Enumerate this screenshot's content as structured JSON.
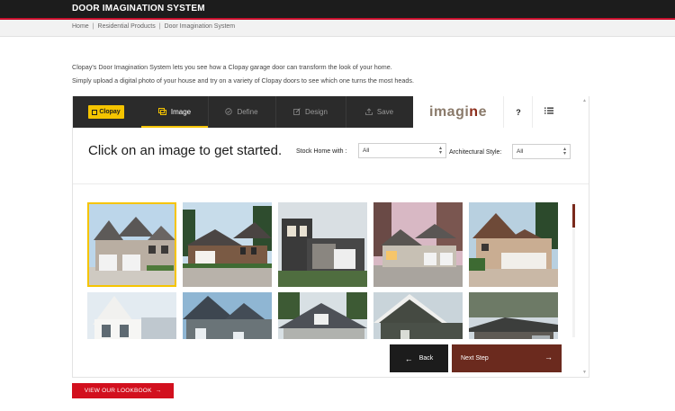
{
  "header": {
    "title": "DOOR IMAGINATION SYSTEM"
  },
  "breadcrumbs": [
    "Home",
    "Residential Products",
    "Door Imagination System"
  ],
  "intro": {
    "line1": "Clopay's Door Imagination System lets you see how a Clopay garage door can transform the look of your home.",
    "line2": "Simply upload a digital photo of your house and try on a variety of Clopay doors to see which one turns the most heads."
  },
  "nav": {
    "logo": "Clopay",
    "tabs": [
      {
        "label": "Image",
        "icon": "image-icon"
      },
      {
        "label": "Define",
        "icon": "check-icon"
      },
      {
        "label": "Design",
        "icon": "edit-icon"
      },
      {
        "label": "Save",
        "icon": "upload-icon"
      }
    ],
    "brand_main": "imagi",
    "brand_accent": "n",
    "brand_tail": "e",
    "help": "?",
    "menu_icon": "list-icon"
  },
  "filters": {
    "headline": "Click on an image to get started.",
    "stock_label": "Stock Home with :",
    "stock_value": "All",
    "arch_label": "Architectural Style:",
    "arch_value": "All"
  },
  "buttons": {
    "back": "Back",
    "next": "Next Step",
    "lookbook": "VIEW OUR LOOKBOOK"
  },
  "colors": {
    "accent_yellow": "#f5c400",
    "brand_red": "#d2101e",
    "next_brown": "#6b2a1e"
  }
}
